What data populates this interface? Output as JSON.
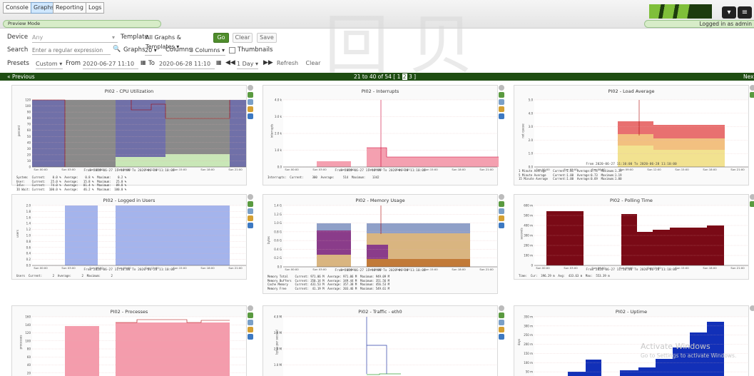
{
  "tabs": [
    "Console",
    "Graphs",
    "Reporting",
    "Logs"
  ],
  "active_tab": "Graphs",
  "preview_mode": "Preview Mode",
  "logged_in": "Logged in as admin",
  "device": {
    "label": "Device",
    "value": "Any"
  },
  "template": {
    "label": "Template",
    "value": "All Graphs & Templates"
  },
  "go_label": "Go",
  "clear_label": "Clear",
  "save_label": "Save",
  "search": {
    "label": "Search",
    "placeholder": "Enter a regular expression"
  },
  "graphs": {
    "label": "Graphs",
    "value": "20"
  },
  "columns": {
    "label": "Columns",
    "value": "3 Columns"
  },
  "thumbnails_label": "Thumbnails",
  "presets": {
    "label": "Presets",
    "value": "Custom"
  },
  "from": {
    "label": "From",
    "value": "2020-06-27 11:10"
  },
  "to": {
    "label": "To",
    "value": "2020-06-28 11:10"
  },
  "timespan": "1 Day",
  "refresh_label": "Refresh",
  "clear2_label": "Clear",
  "nav": {
    "previous": "« Previous",
    "range": "21 to 40 of 54 [ 1 ",
    "page2": "2",
    "page3": " 3 ]",
    "next": "Nex"
  },
  "from_to": "From 2020-06-27 11:10:00 To 2020-06-28 11:10:00",
  "xticks": [
    "Sun 00:00",
    "Sun 03:00",
    "Sun 06:00",
    "Sun 09:00",
    "Sun 12:00",
    "Sun 15:00",
    "Sun 18:00",
    "Sun 21:00"
  ],
  "graphs_list": [
    {
      "title": "PI02 - CPU Utilization",
      "ylabel": "percent",
      "yticks": [
        "120",
        "100",
        "90",
        "80",
        "70",
        "60",
        "50",
        "40",
        "30",
        "20",
        "10",
        "0"
      ],
      "legend": "System:  Current:    0.0 %  Average:    0.8 %  Maximum:    0.2 %\nUser:    Current:   25.0 %  Average:   15.8 %  Maximum:   25.0 %\nIdle:    Current:   74.0 %  Average:   81.4 %  Maximum:   89.8 %\nIO Wait: Current:  100.0 %  Average:   46.2 %  Maximum:  100.0 %"
    },
    {
      "title": "PI02 - Interrupts",
      "ylabel": "interrupts",
      "yticks": [
        "4.0 k",
        "3.0 k",
        "2.0 k",
        "1.0 k",
        "0.0"
      ],
      "legend": "Interrupts:  Current:     300  Average:     514  Maximum:    1342"
    },
    {
      "title": "PI02 - Load Average",
      "ylabel": "not queue",
      "yticks": [
        "5.0",
        "4.0",
        "3.0",
        "2.0",
        "1.0",
        "0.0"
      ],
      "legend": "1 Minute Average    Current:1.01  Average:0.74  Maximum:1.39\n5 Minute Average    Current:1.00  Average:0.73  Maximum:1.19\n15 Minute Average   Current:1.00  Average:0.69  Maximum:1.00"
    },
    {
      "title": "PI02 - Logged in Users",
      "ylabel": "users",
      "yticks": [
        "2.0",
        "1.8",
        "1.6",
        "1.4",
        "1.2",
        "1.0",
        "0.8",
        "0.6",
        "0.4",
        "0.2",
        "0.0"
      ],
      "legend": "Users  Current:      2  Average:      2  Maximum:      2"
    },
    {
      "title": "PI02 - Memory Usage",
      "ylabel": "bytes",
      "yticks": [
        "1.4 G",
        "1.2 G",
        "1.0 G",
        "0.8 G",
        "0.6 G",
        "0.4 G",
        "0.2 G",
        "0.0"
      ],
      "legend": "Memory Total    Current: 971.06 M  Average: 971.06 M  Maximum: 949.09 M\nMemory Buffers  Current: 350.14 M  Average: 349.44 M  Maximum: 351.56 M\nCache Memory    Current: 431.53 M  Average: 357.38 M  Maximum: 456.53 M\nMemory Free     Current:  41.19 M  Average: 203.46 M  Maximum: 549.61 M"
    },
    {
      "title": "PI02 - Polling Time",
      "ylabel": "seconds",
      "yticks": [
        "600 m",
        "500 m",
        "400 m",
        "300 m",
        "200 m",
        "100 m",
        "0"
      ],
      "legend": "Time:  Cur:  396.29 m  Avg:  433.63 m  Max:  553.39 m"
    },
    {
      "title": "PI02 - Processes",
      "ylabel": "processes",
      "yticks": [
        "160",
        "140",
        "120",
        "100",
        "80",
        "60",
        "40",
        "20",
        "0"
      ],
      "legend": ""
    },
    {
      "title": "PI02 - Traffic - eth0",
      "ylabel": "bytes per second",
      "yticks": [
        "4.0 M",
        "3.0 M",
        "2.0 M",
        "1.0 M",
        "0.0"
      ],
      "legend": ""
    },
    {
      "title": "PI02 - Uptime",
      "ylabel": "days",
      "yticks": [
        "350 m",
        "300 m",
        "250 m",
        "200 m",
        "150 m",
        "100 m",
        "50 m",
        "0"
      ],
      "legend": ""
    }
  ],
  "activate": {
    "title": "Activate Windows",
    "sub": "Go to Settings to activate Windows."
  },
  "watermark": "回 贝"
}
